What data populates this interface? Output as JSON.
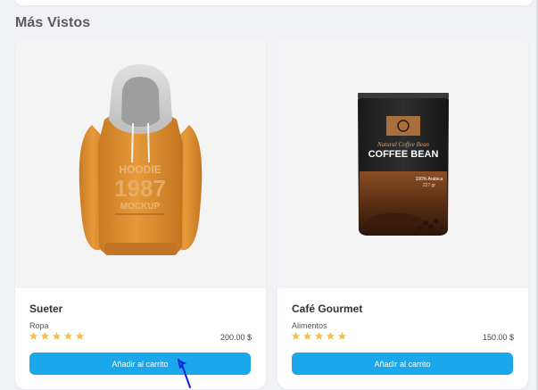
{
  "section": {
    "title": "Más Vistos"
  },
  "colors": {
    "accent": "#1aa7ec",
    "star": "#f6c04b",
    "cursor": "#0b22d8"
  },
  "products": [
    {
      "name": "Sueter",
      "category": "Ropa",
      "rating": 5,
      "price": "200.00 $",
      "button_label": "Añadir al carrito",
      "image": {
        "icon": "hoodie-image",
        "print_line1": "HOODIE",
        "print_line2": "1987",
        "print_line3": "MOCKUP"
      }
    },
    {
      "name": "Café Gourmet",
      "category": "Alimentos",
      "rating": 5,
      "price": "150.00 $",
      "button_label": "Añadir al carrito",
      "image": {
        "icon": "coffee-bag-image",
        "tagline": "Natural Coffee Bean",
        "brand": "COFFEE BEAN",
        "detail_line1": "100% Arabica",
        "detail_line2": "227 gr"
      }
    }
  ]
}
